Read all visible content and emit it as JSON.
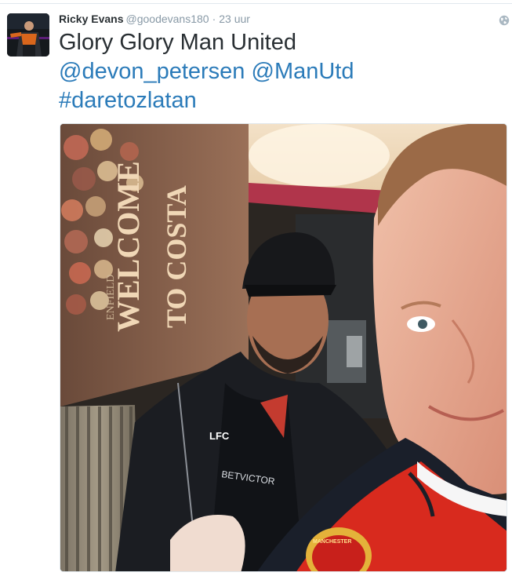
{
  "tweet": {
    "author_name": "Ricky Evans",
    "author_handle": "@goodevans180",
    "separator": "·",
    "timestamp": "23 uur",
    "text_line1": "Glory Glory Man United",
    "mention1": "@devon_petersen",
    "mention2": "@ManUtd",
    "hashtag": "#daretozlatan"
  },
  "media": {
    "wall_text_welcome": "WELCOME",
    "wall_text_tocosta": "TO COSTA",
    "wall_text_enfield": "ENFIELD",
    "shirt_text_betvictor": "BETVICTOR",
    "shirt_text_lfc": "LFC",
    "crest_text": "MANCHESTER"
  },
  "icons": {
    "globe": "globe-icon"
  },
  "colors": {
    "link": "#2b7bb9",
    "name": "#292f33",
    "meta": "#8899a6",
    "border": "#e1e8ed"
  }
}
